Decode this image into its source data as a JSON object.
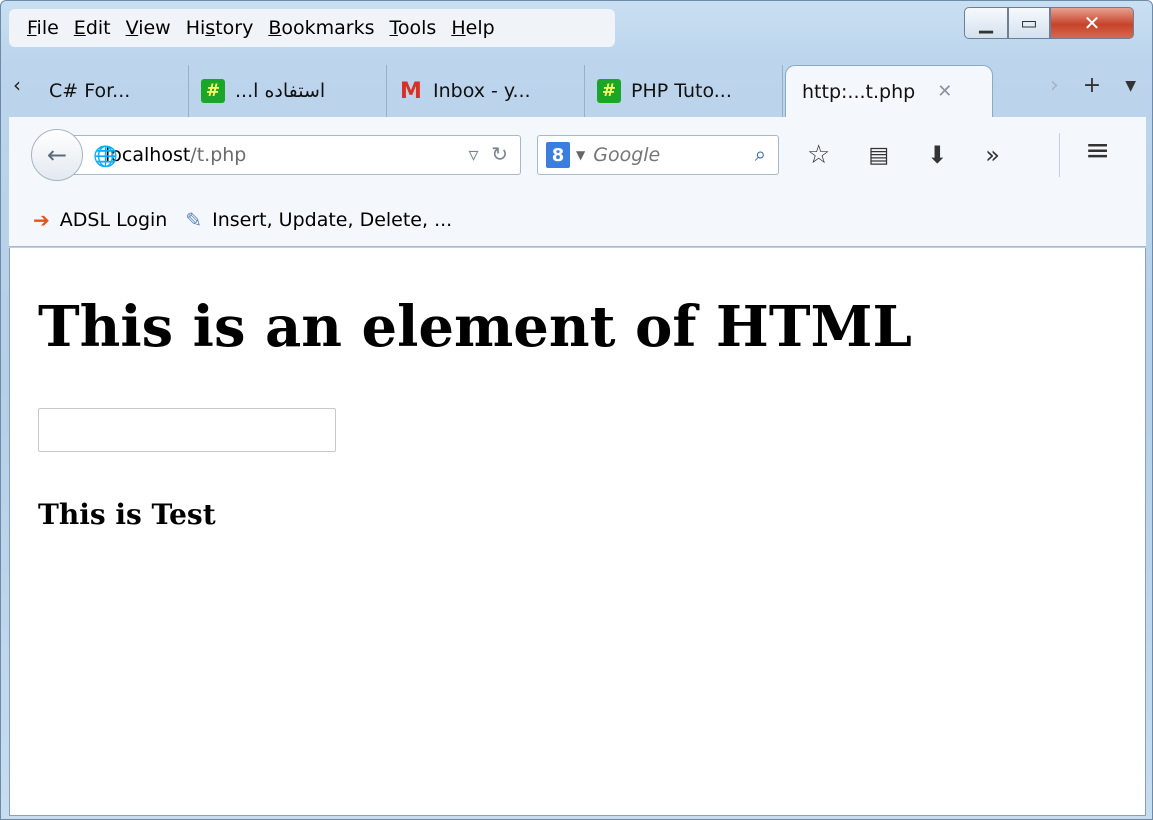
{
  "menubar": {
    "items": [
      {
        "u": "F",
        "rest": "ile"
      },
      {
        "u": "E",
        "rest": "dit"
      },
      {
        "u": "V",
        "rest": "iew"
      },
      {
        "pre": "Hi",
        "u": "s",
        "rest": "tory"
      },
      {
        "u": "B",
        "rest": "ookmarks"
      },
      {
        "u": "T",
        "rest": "ools"
      },
      {
        "u": "H",
        "rest": "elp"
      }
    ]
  },
  "tabs": [
    {
      "label": "C# For...",
      "icon": "none"
    },
    {
      "label": "...استفاده ا",
      "icon": "hash-icon"
    },
    {
      "label": "Inbox - y...",
      "icon": "gmail-icon"
    },
    {
      "label": "PHP Tuto...",
      "icon": "hash-icon"
    },
    {
      "label": "http:...t.php",
      "icon": "none",
      "active": true
    }
  ],
  "tab_close_glyph": "✕",
  "navbar": {
    "url_host": "localhost",
    "url_path": "/t.php",
    "search_placeholder": "Google",
    "search_engine_letter": "8"
  },
  "bookmarks": [
    {
      "label": "ADSL Login",
      "icon": "arrow-icon"
    },
    {
      "label": "Insert, Update, Delete, ...",
      "icon": "page-icon"
    }
  ],
  "page": {
    "heading": "This is an element of HTML",
    "input_value": "",
    "subheading": "This is Test"
  },
  "colors": {
    "close_button": "#c7432b",
    "hash_icon_bg": "#1aa728",
    "gmail_red": "#d93025",
    "google_blue": "#3c7ee0"
  }
}
